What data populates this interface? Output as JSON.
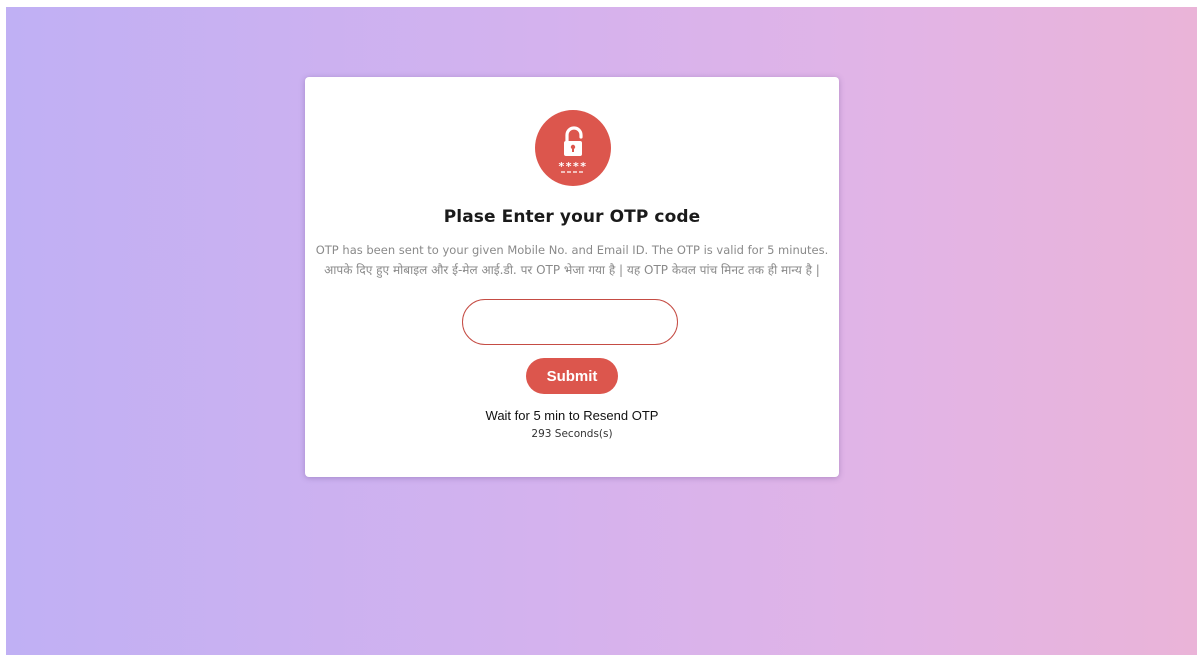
{
  "otp": {
    "icon": "lock-icon",
    "icon_mask": "****",
    "title": "Plase Enter your OTP code",
    "message_en": "OTP has been sent to your given Mobile No. and Email ID. The OTP is valid for 5 minutes.",
    "message_hi": "आपके दिए हुए मोबाइल और ई-मेल आई.डी. पर OTP भेजा गया है | यह OTP केवल पांच मिनट तक ही मान्य है |",
    "input_value": "",
    "input_placeholder": "",
    "submit_label": "Submit",
    "resend_text": "Wait for 5 min to Resend OTP",
    "countdown": "293 Seconds(s)"
  },
  "colors": {
    "accent": "#dc564d",
    "gradient_start": "#c0b0f4",
    "gradient_end": "#eab4d8"
  }
}
